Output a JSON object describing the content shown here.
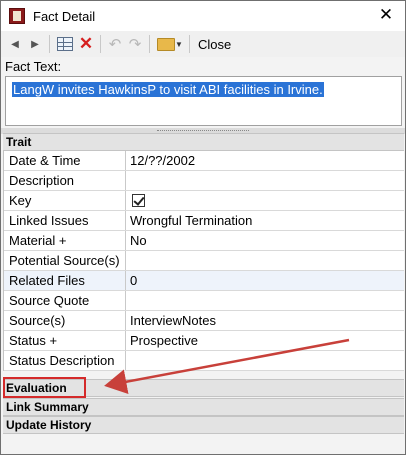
{
  "window": {
    "title": "Fact Detail",
    "close_glyph": "✕"
  },
  "toolbar": {
    "back_icon": "triangle-left-icon",
    "forward_icon": "triangle-right-icon",
    "close_label": "Close"
  },
  "fact": {
    "label": "Fact Text:",
    "text": "LangW invites HawkinsP to visit ABI facilities in Irvine."
  },
  "sections": {
    "trait": "Trait",
    "evaluation": "Evaluation",
    "link_summary": "Link Summary",
    "update_history": "Update History"
  },
  "traits": [
    {
      "name": "Date & Time",
      "value": "12/??/2002"
    },
    {
      "name": "Description",
      "value": ""
    },
    {
      "name": "Key",
      "value": "",
      "checked": true
    },
    {
      "name": "Linked Issues",
      "value": "Wrongful Termination"
    },
    {
      "name": "Material +",
      "value": "No"
    },
    {
      "name": "Potential Source(s)",
      "value": ""
    },
    {
      "name": "Related Files",
      "value": "0"
    },
    {
      "name": "Source Quote",
      "value": ""
    },
    {
      "name": "Source(s)",
      "value": "InterviewNotes"
    },
    {
      "name": "Status +",
      "value": "Prospective"
    },
    {
      "name": "Status Description",
      "value": ""
    }
  ],
  "colors": {
    "selection": "#2a73d6",
    "annotation": "#d42a2a",
    "delete_icon": "#d61f1f"
  }
}
